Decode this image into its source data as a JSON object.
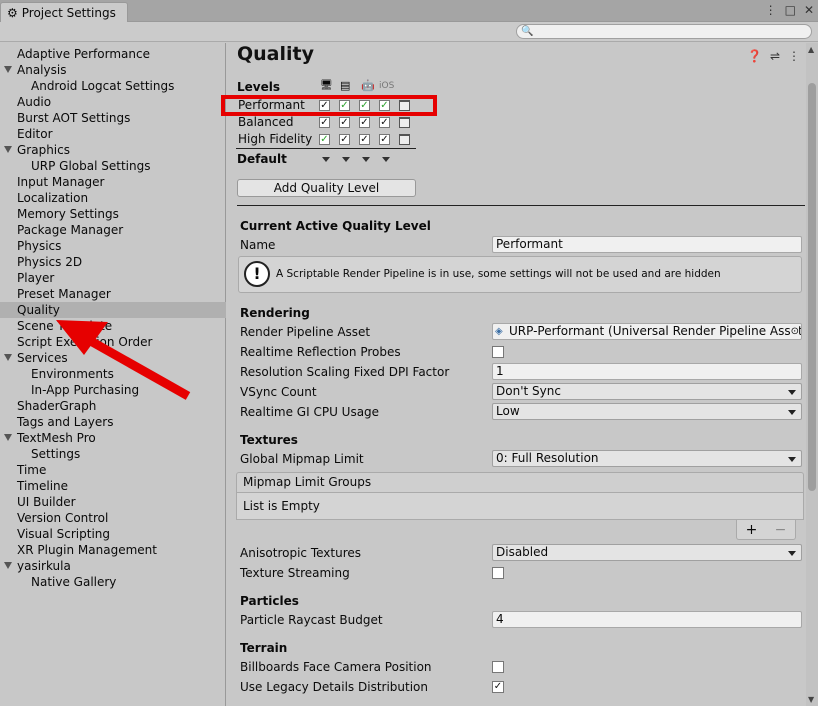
{
  "window": {
    "tab_title": "Project Settings",
    "controls": [
      "⋮",
      "□",
      "✕"
    ]
  },
  "search": {
    "placeholder": ""
  },
  "sidebar": {
    "items": [
      {
        "label": "Adaptive Performance",
        "indent": 0,
        "foldout": false
      },
      {
        "label": "Analysis",
        "indent": 0,
        "foldout": true
      },
      {
        "label": "Android Logcat Settings",
        "indent": 1,
        "foldout": false
      },
      {
        "label": "Audio",
        "indent": 0,
        "foldout": false
      },
      {
        "label": "Burst AOT Settings",
        "indent": 0,
        "foldout": false
      },
      {
        "label": "Editor",
        "indent": 0,
        "foldout": false
      },
      {
        "label": "Graphics",
        "indent": 0,
        "foldout": true
      },
      {
        "label": "URP Global Settings",
        "indent": 1,
        "foldout": false
      },
      {
        "label": "Input Manager",
        "indent": 0,
        "foldout": false
      },
      {
        "label": "Localization",
        "indent": 0,
        "foldout": false
      },
      {
        "label": "Memory Settings",
        "indent": 0,
        "foldout": false
      },
      {
        "label": "Package Manager",
        "indent": 0,
        "foldout": false
      },
      {
        "label": "Physics",
        "indent": 0,
        "foldout": false
      },
      {
        "label": "Physics 2D",
        "indent": 0,
        "foldout": false
      },
      {
        "label": "Player",
        "indent": 0,
        "foldout": false
      },
      {
        "label": "Preset Manager",
        "indent": 0,
        "foldout": false
      },
      {
        "label": "Quality",
        "indent": 0,
        "foldout": false,
        "selected": true
      },
      {
        "label": "Scene Template",
        "indent": 0,
        "foldout": false
      },
      {
        "label": "Script Execution Order",
        "indent": 0,
        "foldout": false
      },
      {
        "label": "Services",
        "indent": 0,
        "foldout": true
      },
      {
        "label": "Environments",
        "indent": 1,
        "foldout": false
      },
      {
        "label": "In-App Purchasing",
        "indent": 1,
        "foldout": false
      },
      {
        "label": "ShaderGraph",
        "indent": 0,
        "foldout": false
      },
      {
        "label": "Tags and Layers",
        "indent": 0,
        "foldout": false
      },
      {
        "label": "TextMesh Pro",
        "indent": 0,
        "foldout": true
      },
      {
        "label": "Settings",
        "indent": 1,
        "foldout": false
      },
      {
        "label": "Time",
        "indent": 0,
        "foldout": false
      },
      {
        "label": "Timeline",
        "indent": 0,
        "foldout": false
      },
      {
        "label": "UI Builder",
        "indent": 0,
        "foldout": false
      },
      {
        "label": "Version Control",
        "indent": 0,
        "foldout": false
      },
      {
        "label": "Visual Scripting",
        "indent": 0,
        "foldout": false
      },
      {
        "label": "XR Plugin Management",
        "indent": 0,
        "foldout": false
      },
      {
        "label": "yasirkula",
        "indent": 0,
        "foldout": true
      },
      {
        "label": "Native Gallery",
        "indent": 1,
        "foldout": false
      }
    ]
  },
  "quality": {
    "title": "Quality",
    "levels_label": "Levels",
    "platform_icons": [
      "standalone-icon",
      "server-icon",
      "android-icon",
      "ios-icon"
    ],
    "ios_label": "iOS",
    "levels": [
      {
        "name": "Performant",
        "checks": [
          true,
          true,
          true,
          true
        ],
        "green": [
          false,
          true,
          true,
          true
        ]
      },
      {
        "name": "Balanced",
        "checks": [
          true,
          true,
          true,
          true
        ],
        "green": [
          false,
          false,
          false,
          false
        ]
      },
      {
        "name": "High Fidelity",
        "checks": [
          true,
          true,
          true,
          true
        ],
        "green": [
          true,
          false,
          false,
          false
        ]
      }
    ],
    "default_label": "Default",
    "add_button": "Add Quality Level",
    "current_section": "Current Active Quality Level",
    "name_label": "Name",
    "name_value": "Performant",
    "info_text": "A Scriptable Render Pipeline is in use, some settings will not be used and are hidden",
    "rendering": {
      "header": "Rendering",
      "render_pipeline_label": "Render Pipeline Asset",
      "render_pipeline_value": "URP-Performant (Universal Render Pipeline Asset",
      "reflection_label": "Realtime Reflection Probes",
      "reflection_checked": false,
      "dpi_label": "Resolution Scaling Fixed DPI Factor",
      "dpi_value": "1",
      "vsync_label": "VSync Count",
      "vsync_value": "Don't Sync",
      "gi_label": "Realtime GI CPU Usage",
      "gi_value": "Low"
    },
    "textures": {
      "header": "Textures",
      "mipmap_label": "Global Mipmap Limit",
      "mipmap_value": "0: Full Resolution",
      "groups_header": "Mipmap Limit Groups",
      "groups_empty": "List is Empty",
      "plus": "+",
      "minus": "−",
      "aniso_label": "Anisotropic Textures",
      "aniso_value": "Disabled",
      "streaming_label": "Texture Streaming",
      "streaming_checked": false
    },
    "particles": {
      "header": "Particles",
      "raycast_label": "Particle Raycast Budget",
      "raycast_value": "4"
    },
    "terrain": {
      "header": "Terrain",
      "billboards_label": "Billboards Face Camera Position",
      "billboards_checked": false,
      "legacy_label": "Use Legacy Details Distribution",
      "legacy_checked": true
    }
  },
  "colors": {
    "highlight": "#e60000",
    "arrow": "#e60000",
    "check_green": "#2da12d"
  }
}
